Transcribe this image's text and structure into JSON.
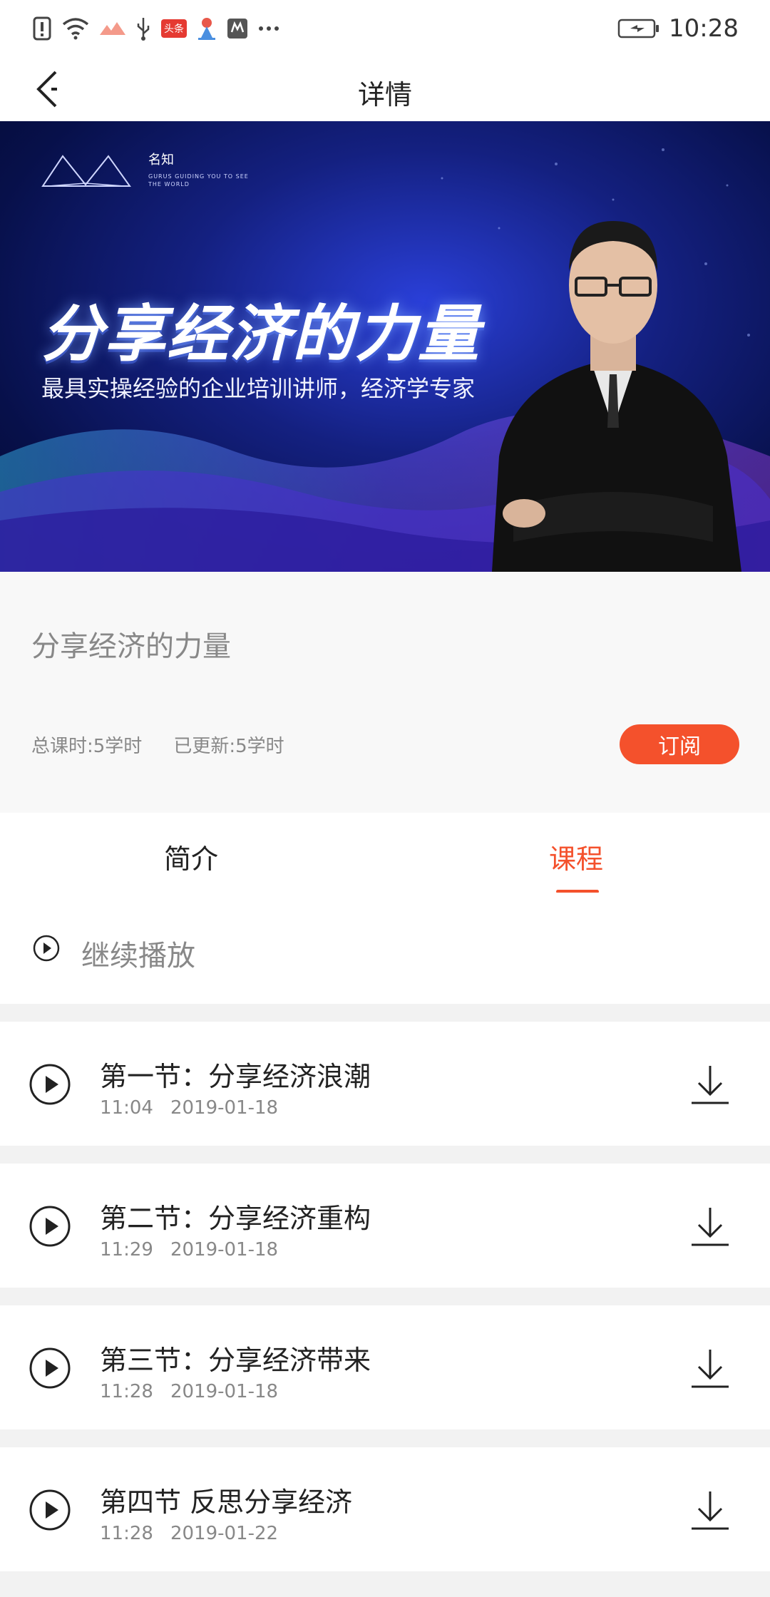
{
  "status_bar": {
    "time": "10:28",
    "badge": "头条"
  },
  "nav": {
    "title": "详情"
  },
  "banner": {
    "brand_name": "名知",
    "brand_sub_1": "GURUS GUIDING YOU TO SEE",
    "brand_sub_2": "THE WORLD",
    "headline": "分享经济的力量",
    "subheadline": "最具实操经验的企业培训讲师，经济学专家"
  },
  "course": {
    "title": "分享经济的力量",
    "total_hours": "总课时:5学时",
    "updated": "已更新:5学时",
    "subscribe_label": "订阅"
  },
  "tabs": [
    {
      "label": "简介",
      "active": false
    },
    {
      "label": "课程",
      "active": true
    }
  ],
  "continue_label": "继续播放",
  "accent_color": "#f4512c",
  "lessons": [
    {
      "title": "第一节：分享经济浪潮",
      "duration": "11:04",
      "date": "2019-01-18"
    },
    {
      "title": "第二节：分享经济重构",
      "duration": "11:29",
      "date": "2019-01-18"
    },
    {
      "title": "第三节：分享经济带来",
      "duration": "11:28",
      "date": "2019-01-18"
    },
    {
      "title": "第四节 反思分享经济",
      "duration": "11:28",
      "date": "2019-01-22"
    }
  ]
}
